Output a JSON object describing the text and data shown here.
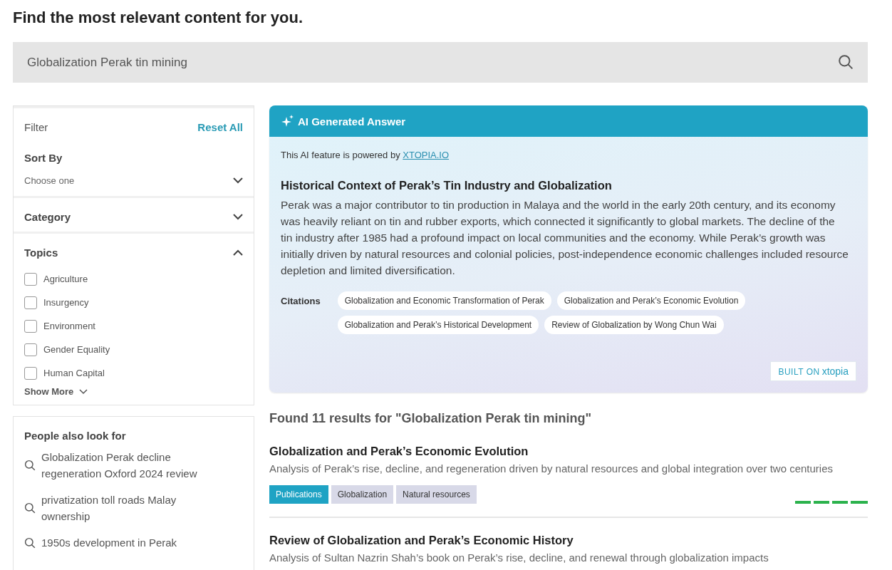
{
  "heading": "Find the most relevant content for you.",
  "search": {
    "value": "Globalization Perak tin mining"
  },
  "filter": {
    "title": "Filter",
    "reset": "Reset All",
    "sort": {
      "label": "Sort By",
      "placeholder": "Choose one",
      "expanded": false
    },
    "sections": [
      {
        "label": "Category",
        "expanded": false
      },
      {
        "label": "Topics",
        "expanded": true,
        "options": [
          {
            "label": "Agriculture",
            "checked": false
          },
          {
            "label": "Insurgency",
            "checked": false
          },
          {
            "label": "Environment",
            "checked": false
          },
          {
            "label": "Gender Equality",
            "checked": false
          },
          {
            "label": "Human Capital",
            "checked": false
          }
        ],
        "more": "Show More"
      }
    ]
  },
  "suggestions": {
    "title": "People also look for",
    "items": [
      "Globalization Perak decline regeneration Oxford 2024 review",
      "privatization toll roads Malay ownership",
      "1950s development in Perak"
    ]
  },
  "ai_answer": {
    "title": "AI Generated Answer",
    "powered_by": "This AI feature is powered by",
    "link": "XTOPIA.IO",
    "heading": "Historical Context of Perak’s Tin Industry and Globalization",
    "body": "Perak was a major contributor to tin production in Malaya and the world in the early 20th century, and its economy was heavily reliant on tin and rubber exports, which connected it significantly to global markets. The decline of the tin industry after 1985 had a profound impact on local communities and the economy. While Perak’s growth was initially driven by natural resources and colonial policies, post-independence economic challenges included resource depletion and limited diversification.",
    "citations_label": "Citations",
    "citations": [
      "Globalization and Economic Transformation of Perak",
      "Globalization and Perak’s Economic Evolution",
      "Globalization and Perak’s Historical Development",
      "Review of Globalization by Wong Chun Wai"
    ],
    "badge": {
      "prefix": "BUILT ON",
      "logo": "xtopia"
    }
  },
  "results": {
    "summary": "Found 11 results for \"Globalization Perak tin mining\"",
    "items": [
      {
        "title": "Globalization and Perak’s Economic Evolution",
        "description": "Analysis of Perak’s rise, decline, and regeneration driven by natural resources and global integration over two centuries",
        "tags": [
          {
            "label": "Publications",
            "kind": "type"
          },
          {
            "label": "Globalization",
            "kind": "topic"
          },
          {
            "label": "Natural resources",
            "kind": "topic"
          }
        ]
      },
      {
        "title": "Review of Globalization and Perak’s Economic History",
        "description": "Analysis of Sultan Nazrin Shah’s book on Perak’s rise, decline, and renewal through globalization impacts"
      }
    ]
  }
}
